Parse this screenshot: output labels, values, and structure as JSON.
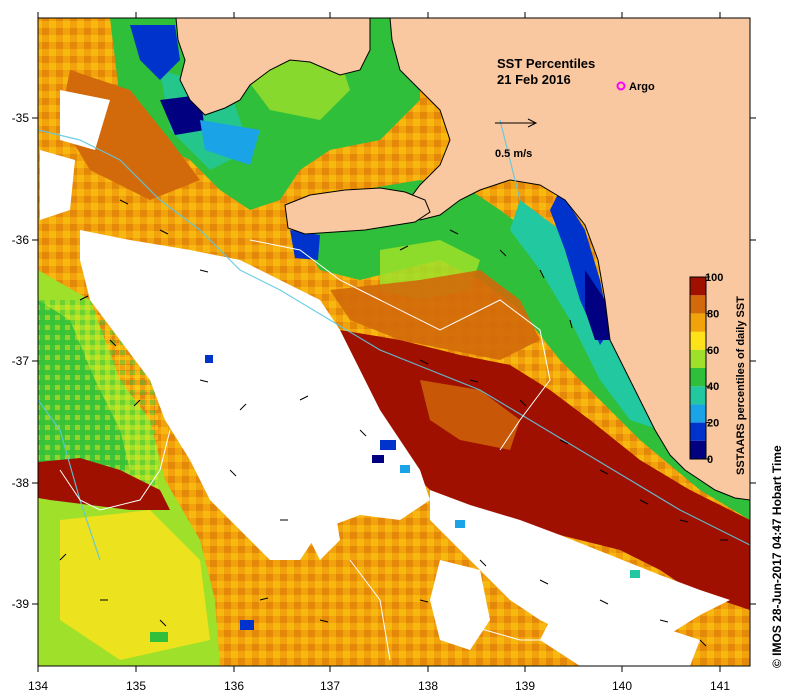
{
  "title": {
    "line1": "SST Percentiles",
    "line2": "21 Feb 2016"
  },
  "legend": {
    "argo_label": "Argo",
    "argo_color": "#ff00ff",
    "vector_label": "0.5 m/s"
  },
  "colorbar": {
    "label": "SSTAARS percentiles of daily  SST",
    "ticks": [
      "0",
      "20",
      "40",
      "60",
      "80",
      "100"
    ],
    "colors": [
      "#000080",
      "#0033cc",
      "#1aa3e6",
      "#22c8a0",
      "#2fbf3a",
      "#9ee02a",
      "#ffe21a",
      "#f2a20a",
      "#d2690a",
      "#a01000"
    ]
  },
  "axes": {
    "x_ticks": [
      "134",
      "135",
      "136",
      "137",
      "138",
      "139",
      "140",
      "141"
    ],
    "y_ticks": [
      "-35",
      "-36",
      "-37",
      "-38",
      "-39"
    ]
  },
  "credit": "© IMOS 28-Jun-2017 04:47 Hobart Time",
  "colors": {
    "land": "#f9c8a0",
    "no_data": "#ffffff",
    "coastline": "#000000",
    "isobath": "#5fc8e0",
    "contour": "#ffffff"
  }
}
